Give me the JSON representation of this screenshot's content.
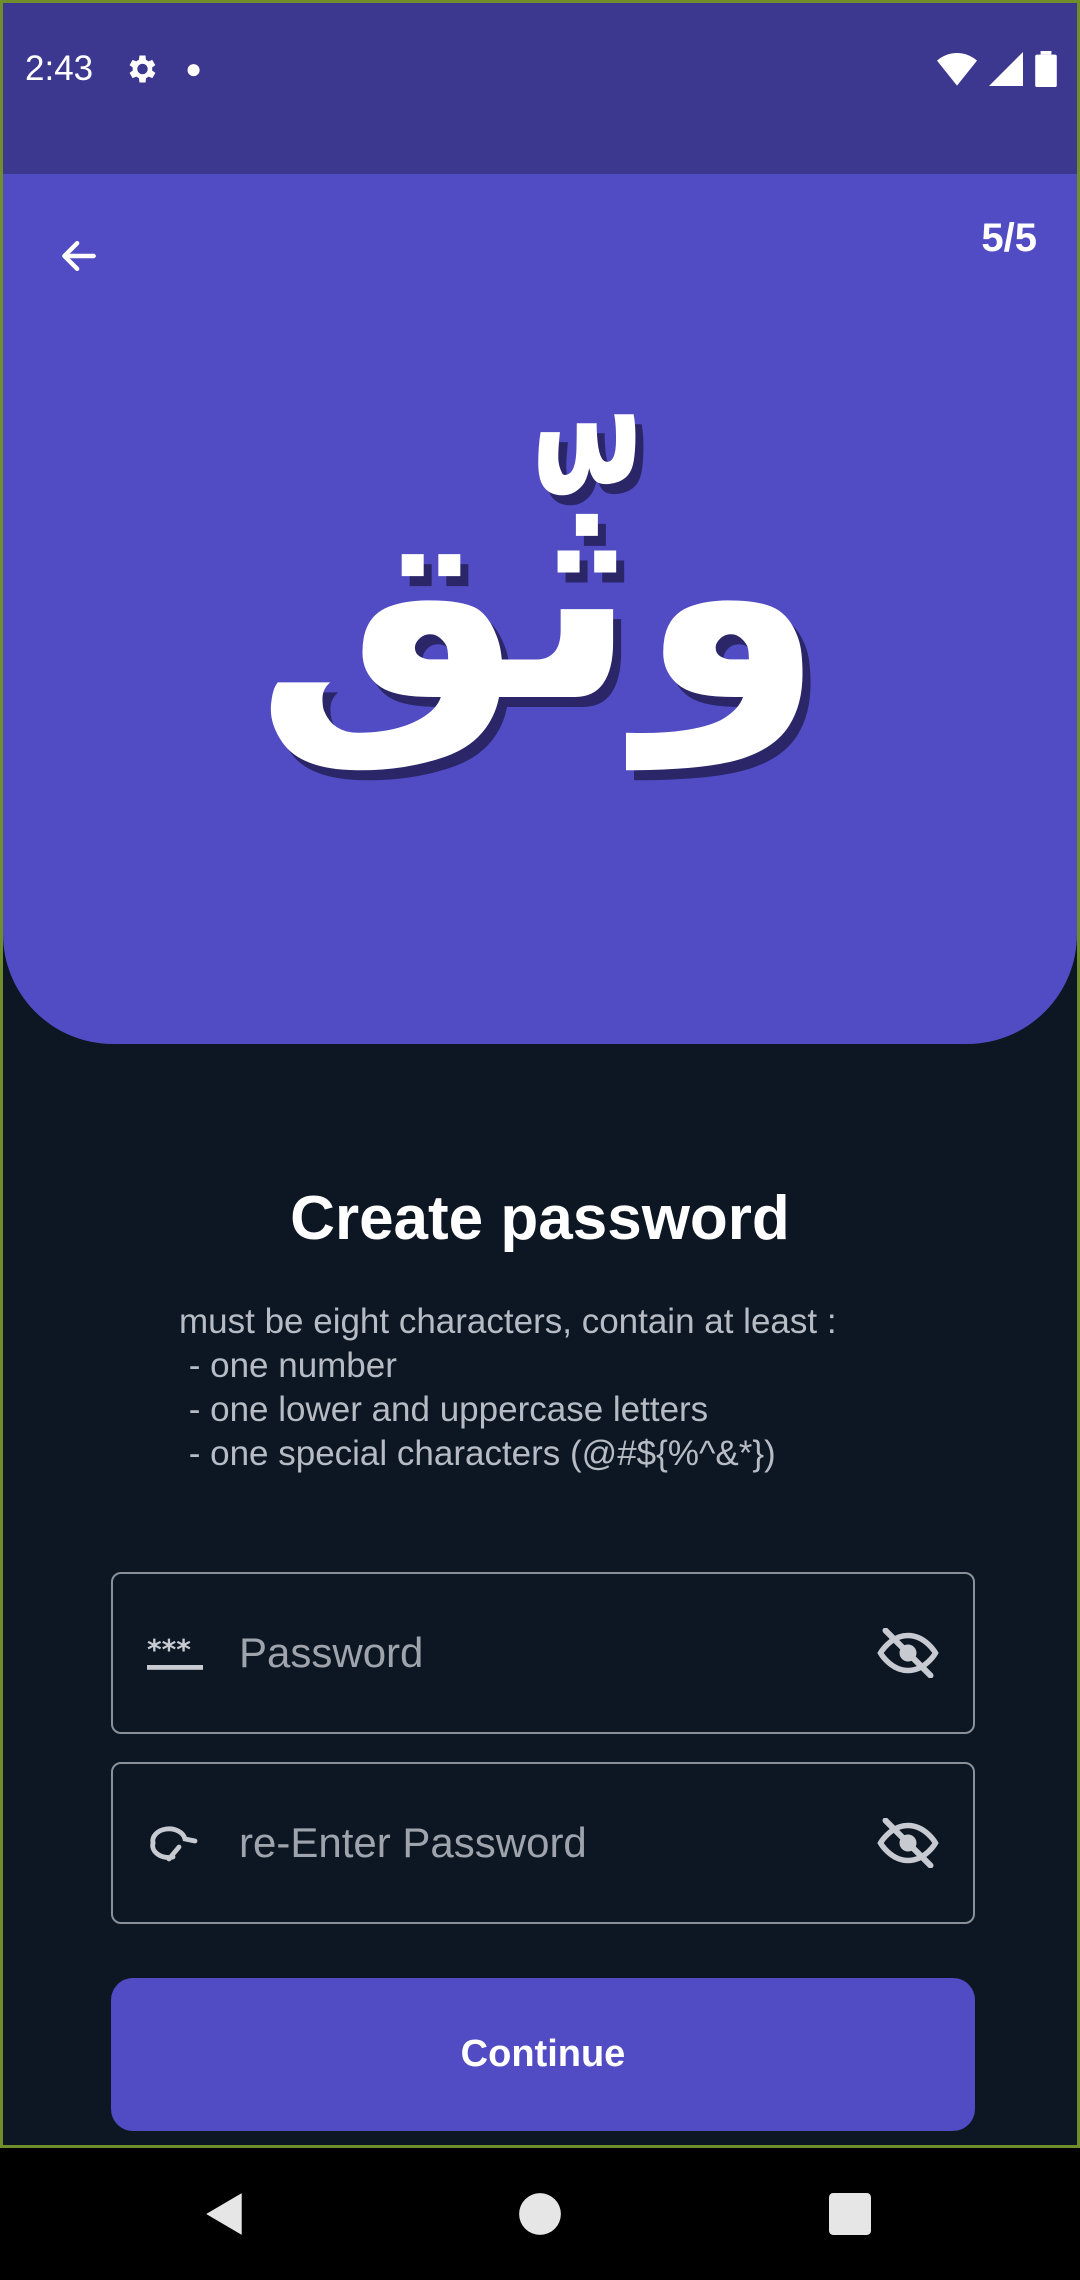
{
  "status_bar": {
    "time": "2:43",
    "icons": [
      "gear-icon",
      "notification-dot-icon",
      "wifi-icon",
      "signal-icon",
      "battery-icon"
    ]
  },
  "header": {
    "step_indicator": "5/5",
    "logo_text": "وثّق",
    "back_icon": "arrow-left-icon"
  },
  "main": {
    "title": "Create password",
    "rules": [
      "must be eight characters, contain at least :",
      " - one number",
      " - one lower and uppercase letters",
      " - one special characters (@#${%^&*})"
    ],
    "password_field": {
      "placeholder": "Password",
      "value": "",
      "lead_icon": "password-icon",
      "toggle_icon": "eye-off-icon"
    },
    "reenter_field": {
      "placeholder": "re-Enter Password",
      "value": "",
      "lead_icon": "redo-icon",
      "toggle_icon": "eye-off-icon"
    },
    "continue_label": "Continue"
  },
  "colors": {
    "accent": "#514cc4",
    "status_bar": "#3d388f",
    "background": "#0d1723"
  },
  "nav_bar": {
    "icons": [
      "back-triangle-icon",
      "home-circle-icon",
      "recents-square-icon"
    ]
  }
}
